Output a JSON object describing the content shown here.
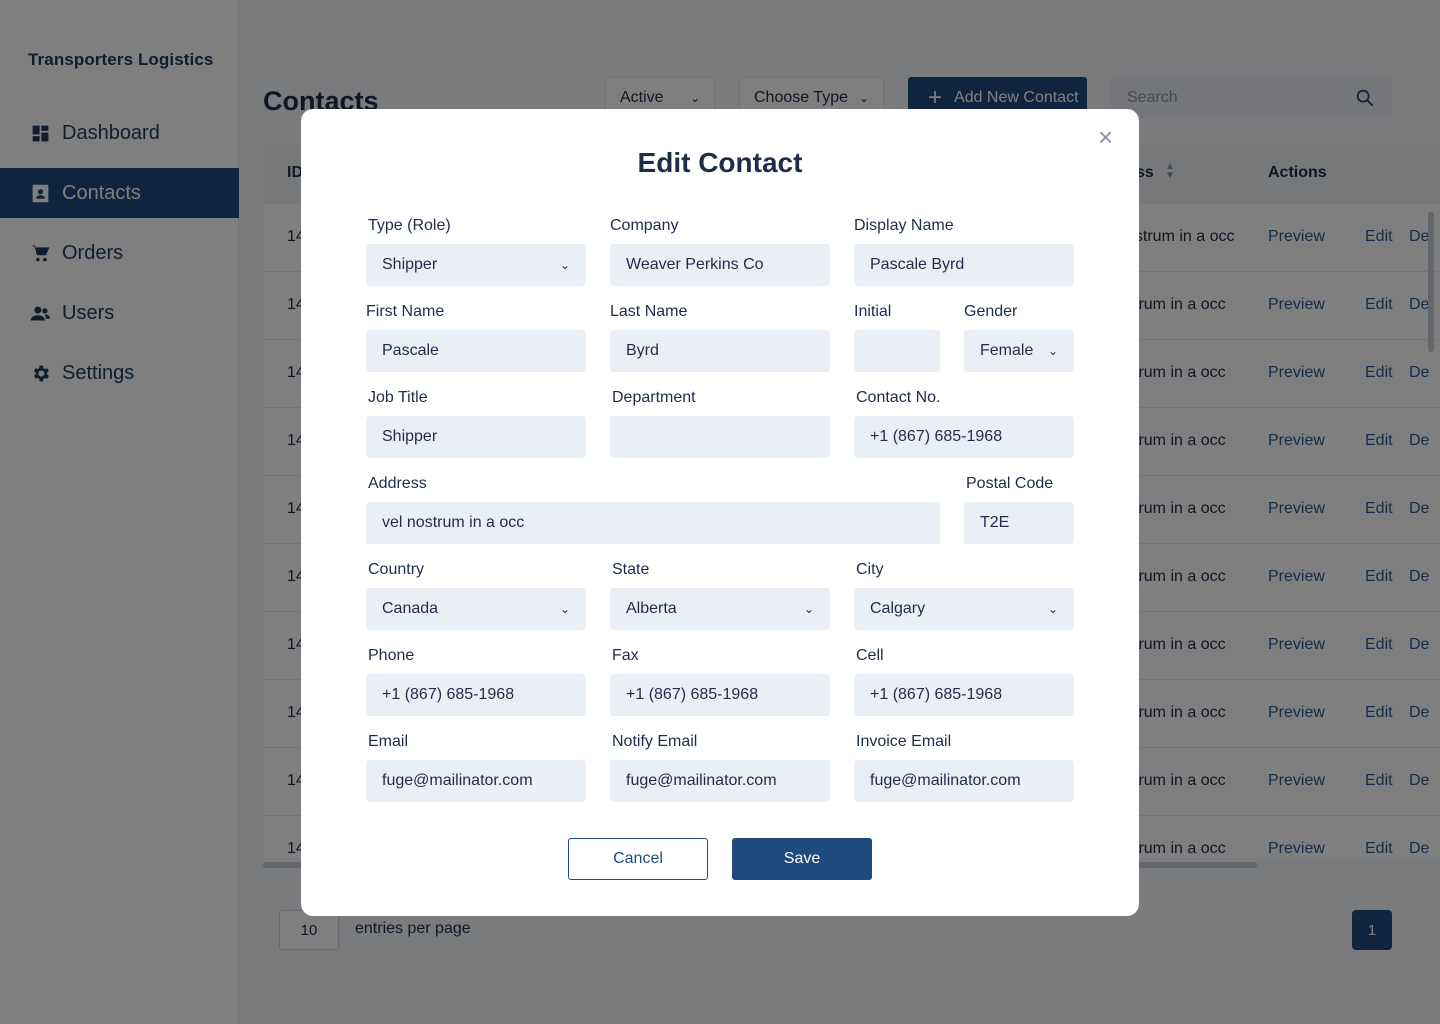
{
  "app": {
    "brand": "Transporters Logistics"
  },
  "sidebar": {
    "items": [
      {
        "label": "Dashboard",
        "icon": "dashboard-icon"
      },
      {
        "label": "Contacts",
        "icon": "contacts-icon",
        "active": true
      },
      {
        "label": "Orders",
        "icon": "cart-icon"
      },
      {
        "label": "Users",
        "icon": "users-icon"
      },
      {
        "label": "Settings",
        "icon": "gear-icon"
      }
    ]
  },
  "toolbar": {
    "title": "Contacts",
    "status_filter": "Active",
    "type_filter": "Choose Type",
    "add_label": "Add New Contact",
    "search_placeholder": "Search"
  },
  "table": {
    "headers": {
      "id": "ID",
      "address": "ss",
      "actions": "Actions"
    },
    "rows": [
      {
        "id": "14",
        "address": "ostrum in a occ"
      },
      {
        "id": "14",
        "address": "strum in a occ"
      },
      {
        "id": "14",
        "address": "strum in a occ"
      },
      {
        "id": "14",
        "address": "strum in a occ"
      },
      {
        "id": "14",
        "address": "strum in a occ"
      },
      {
        "id": "14",
        "address": "strum in a occ"
      },
      {
        "id": "14",
        "address": "strum in a occ"
      },
      {
        "id": "14",
        "address": "strum in a occ"
      },
      {
        "id": "14",
        "address": "strum in a occ"
      },
      {
        "id": "14",
        "address": "strum in a occ"
      }
    ],
    "action_labels": {
      "preview": "Preview",
      "edit": "Edit",
      "delete": "De"
    }
  },
  "footer": {
    "entries": "10",
    "entries_label": "entries per page",
    "page": "1"
  },
  "modal": {
    "title": "Edit Contact",
    "close": "×",
    "fields": {
      "type": {
        "label": "Type (Role)",
        "value": "Shipper"
      },
      "company": {
        "label": "Company",
        "value": "Weaver Perkins Co"
      },
      "display_name": {
        "label": "Display Name",
        "value": "Pascale Byrd"
      },
      "first_name": {
        "label": "First Name",
        "value": "Pascale"
      },
      "last_name": {
        "label": "Last Name",
        "value": "Byrd"
      },
      "initial": {
        "label": "Initial",
        "value": ""
      },
      "gender": {
        "label": "Gender",
        "value": "Female"
      },
      "job_title": {
        "label": "Job Title",
        "value": "Shipper"
      },
      "department": {
        "label": "Department",
        "value": ""
      },
      "contact_no": {
        "label": "Contact No.",
        "value": "+1 (867) 685-1968"
      },
      "address": {
        "label": "Address",
        "value": "vel nostrum in a occ"
      },
      "postal_code": {
        "label": "Postal Code",
        "value": "T2E"
      },
      "country": {
        "label": "Country",
        "value": "Canada"
      },
      "state": {
        "label": "State",
        "value": "Alberta"
      },
      "city": {
        "label": "City",
        "value": "Calgary"
      },
      "phone": {
        "label": "Phone",
        "value": "+1 (867) 685-1968"
      },
      "fax": {
        "label": "Fax",
        "value": "+1 (867) 685-1968"
      },
      "cell": {
        "label": "Cell",
        "value": "+1 (867) 685-1968"
      },
      "email": {
        "label": "Email",
        "value": "fuge@mailinator.com"
      },
      "notify_email": {
        "label": "Notify Email",
        "value": "fuge@mailinator.com"
      },
      "invoice_email": {
        "label": "Invoice Email",
        "value": "fuge@mailinator.com"
      }
    },
    "cancel_label": "Cancel",
    "save_label": "Save"
  },
  "colors": {
    "primary": "#1f4a7e",
    "field_bg": "#eaeff5",
    "link": "#2d5a93"
  }
}
